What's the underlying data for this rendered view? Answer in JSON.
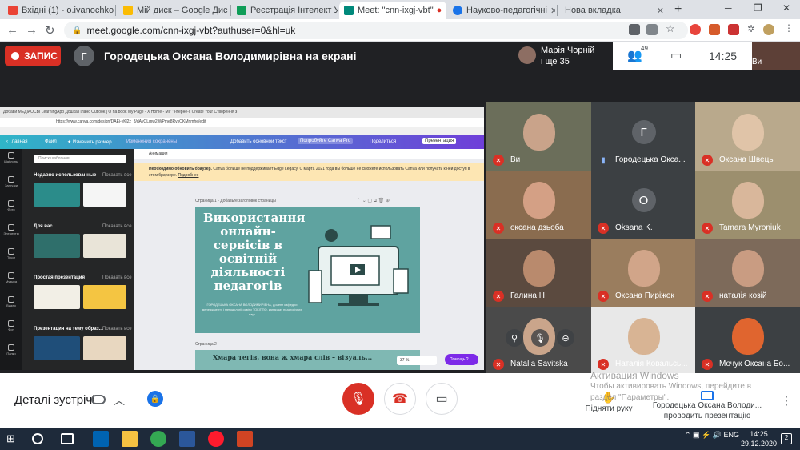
{
  "browser": {
    "tabs": [
      {
        "title": "Вхідні (1) - o.ivanochko",
        "color": "#ea4335"
      },
      {
        "title": "Мій диск – Google Дис",
        "color": "#fbbc04"
      },
      {
        "title": "Реєстрація Інтелект Ук",
        "color": "#0f9d58"
      },
      {
        "title": "Meet: \"cnn-ixgj-vbt\"",
        "color": "#00897b"
      },
      {
        "title": "Науково-педагогічні",
        "color": "#1a73e8"
      },
      {
        "title": "Нова вкладка",
        "color": ""
      }
    ],
    "url": "meet.google.com/cnn-ixgj-vbt?authuser=0&hl=uk"
  },
  "meet": {
    "record_label": "ЗАПИС",
    "presenter_initial": "Г",
    "presenter_title": "Городецька Оксана Володимирівна на екрані",
    "participants_line1": "Марія Чорній",
    "participants_line2": "і ще 35",
    "participant_count": "49",
    "time": "14:25",
    "self_label": "Ви"
  },
  "shared_screen": {
    "inner_tabs": "Добави  МЕДІАОСВІ  LearningApp  Дошка Планс  Outlook | О  ria book  My Page - X  Home - Mir  \"Інтерне-с  Create Your  Створення з",
    "inner_url": "https://www.canva.com/design/DAEi-yKl2z_8/dAyQLmw2lWPme8RvsOKMnmhe/edit",
    "canva_top": {
      "home": "‹ Главная",
      "file": "Файл",
      "resize": "✦ Изменить размер",
      "saved": "Изменения сохранены",
      "add_text": "Добавить основной текст",
      "try_pro": "Попробуйте Canva Pro",
      "share": "Поделиться",
      "present": "Презентация"
    },
    "side_items": [
      "Шаблоны",
      "Загрузки",
      "Фото",
      "Элементы",
      "Текст",
      "Музыка",
      "Видео",
      "Фон",
      "Папки"
    ],
    "search_placeholder": "Поиск шаблонов",
    "sections": [
      {
        "title": "Недавно использованные",
        "all": "Показать все"
      },
      {
        "title": "Для вас",
        "all": "Показать все"
      },
      {
        "title": "Простая презентация",
        "all": "Показать все"
      },
      {
        "title": "Презентация на тему образ...",
        "all": "Показать все"
      }
    ],
    "anim_label": "Анимация",
    "warning_bold": "Необходимо обновить браузер.",
    "warning_text": " Canva больше не поддерживает Edge Legacy. С марта 2021 года вы больше не сможете использовать Canva или получать к ней доступ в этом браузере.",
    "warning_link": "Подробнее",
    "page1_label": "Страница 1 - Добавьте заголовок страницы",
    "slide_title": "Використання онлайн-сервісів в освітній діяльності педагогів",
    "slide_sub": "ГОРОДЕЦЬКА ОКСАНА ВОЛОДИМИРІВНА, доцент кафедри менеджменту і методології освіти ТОКІППО, кандидат педагогічних наук",
    "page2_label": "Страница 2",
    "slide2_title": "Хмара тегів, вона ж хмара слів – візуаль...",
    "zoom": "37 %",
    "help": "Помощь ?"
  },
  "participants": [
    {
      "name": "Ви",
      "kind": "video",
      "face": "#c9a38a",
      "bg": "#6b6e5a",
      "muted": true
    },
    {
      "name": "Городецька Окса...",
      "kind": "avatar",
      "initial": "Г",
      "avatar_color": "#5f6368",
      "muted": false
    },
    {
      "name": "Оксана Швець",
      "kind": "video",
      "face": "#e0c4a8",
      "bg": "#b9a98c",
      "muted": true
    },
    {
      "name": "оксана дзьоба",
      "kind": "video",
      "face": "#d4a085",
      "bg": "#8a6c4f",
      "muted": true
    },
    {
      "name": "Oksana K.",
      "kind": "avatar",
      "initial": "O",
      "avatar_color": "#5f6368",
      "muted": true
    },
    {
      "name": "Tamara Myroniuk",
      "kind": "video",
      "face": "#d9b79b",
      "bg": "#9c8f6e",
      "muted": true
    },
    {
      "name": "Галина Н",
      "kind": "video",
      "face": "#b98a6d",
      "bg": "#5b4a3f",
      "muted": true
    },
    {
      "name": "Оксана Пиріжок",
      "kind": "video",
      "face": "#d1a589",
      "bg": "#9a7d5e",
      "muted": true
    },
    {
      "name": "наталія козій",
      "kind": "video",
      "face": "#c99c82",
      "bg": "#7d6a5a",
      "muted": true
    },
    {
      "name": "Natalia Savitska",
      "kind": "video",
      "face": "#caa58b",
      "bg": "#4a4a4a",
      "muted": true
    },
    {
      "name": "Наталія Ковальсь...",
      "kind": "video",
      "face": "#d8b494",
      "bg": "#e8e8e8",
      "muted": true
    },
    {
      "name": "Мочук Оксана Бо...",
      "kind": "video",
      "face": "#e0652f",
      "bg": "#3c4043",
      "muted": true
    }
  ],
  "bottom": {
    "details": "Деталі зустрічі",
    "raise_hand": "Підняти руку",
    "presenting_line1": "Городецька Оксана Володи...",
    "presenting_line2": "проводить презентацію",
    "activation_title": "Активация Windows",
    "activation_sub1": "Чтобы активировать Windows, перейдите в",
    "activation_sub2": "раздел \"Параметры\"."
  },
  "taskbar": {
    "lang": "ENG",
    "time": "14:25",
    "date": "29.12.2020",
    "notifications": "2"
  }
}
